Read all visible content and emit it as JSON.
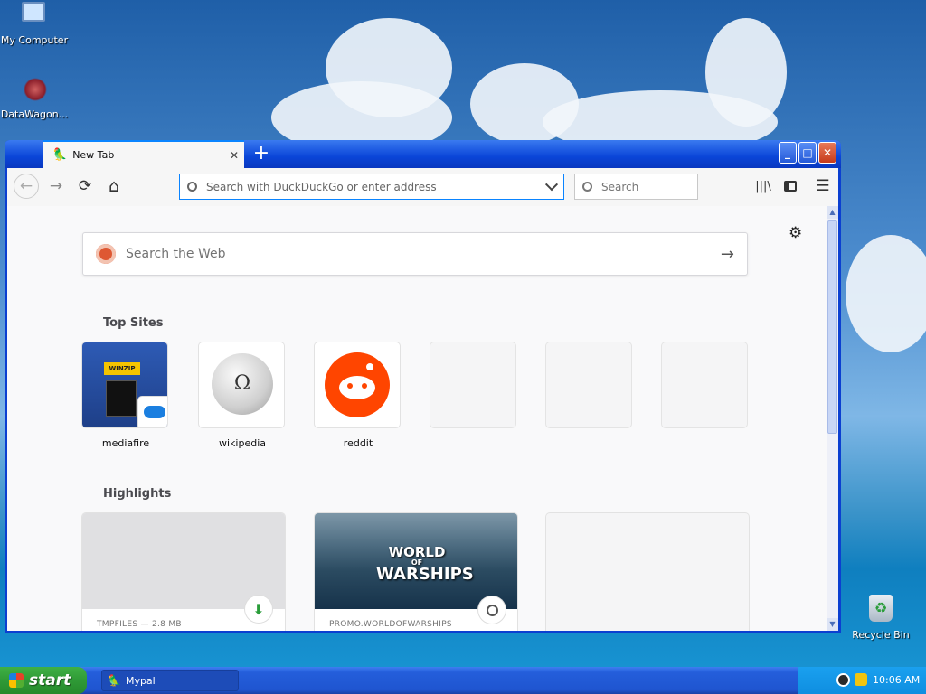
{
  "desktop": {
    "icons": [
      {
        "label": "My Computer",
        "icon": "computer-icon"
      },
      {
        "label": "DataWagon...",
        "icon": "datawagon-icon"
      },
      {
        "label": "Recycle Bin",
        "icon": "recycle-bin-icon"
      }
    ]
  },
  "browser": {
    "tab": {
      "title": "New Tab",
      "close_glyph": "✕",
      "newtab_glyph": "+"
    },
    "window_controls": {
      "minimize": "_",
      "maximize": "□",
      "close": "✕"
    },
    "nav": {
      "back": "←",
      "forward": "→",
      "reload": "⟳",
      "home": "⌂"
    },
    "url": {
      "placeholder": "Search with DuckDuckGo or enter address"
    },
    "search": {
      "placeholder": "Search"
    },
    "toolbar": {
      "library": "|||\\",
      "sidebar": "▯",
      "menu": "☰"
    }
  },
  "newtab": {
    "search": {
      "placeholder": "Search the Web"
    },
    "top_sites_heading": "Top Sites",
    "top_sites": [
      {
        "label": "mediafire"
      },
      {
        "label": "wikipedia"
      },
      {
        "label": "reddit"
      },
      {
        "label": ""
      },
      {
        "label": ""
      },
      {
        "label": ""
      }
    ],
    "highlights_heading": "Highlights",
    "highlights": [
      {
        "caption": "TMPFILES — 2.8 MB",
        "badge": "download-icon"
      },
      {
        "caption": "PROMO.WORLDOFWARSHIPS",
        "badge": "clock-icon",
        "image_text": [
          "WORLD",
          "OF",
          "WARSHIPS"
        ]
      },
      {
        "caption": ""
      }
    ],
    "mediafire_card": {
      "brand": "WINZIP"
    }
  },
  "taskbar": {
    "start": "start",
    "tasks": [
      {
        "label": "Mypal"
      }
    ],
    "clock": "10:06 AM"
  },
  "colors": {
    "accent": "#0a84ff",
    "reddit": "#ff4500",
    "xp_blue": "#245edb",
    "start_green": "#2f9a36"
  }
}
